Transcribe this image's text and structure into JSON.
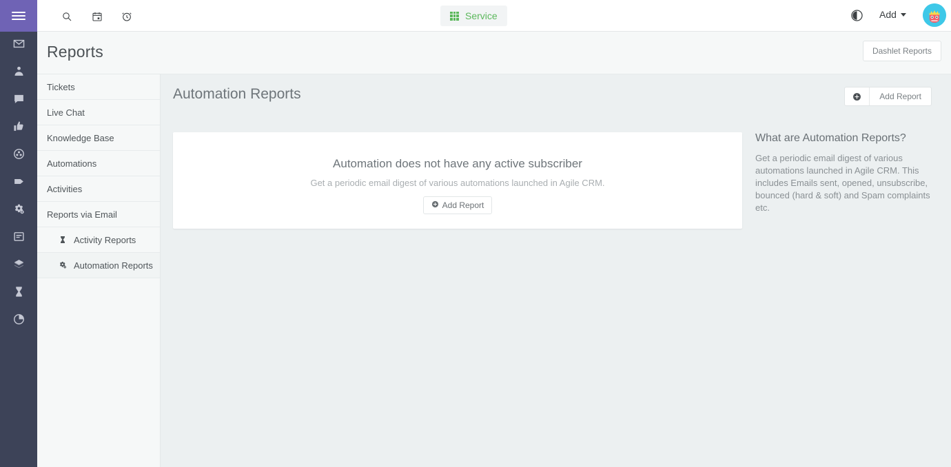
{
  "left_rail": {
    "hamburger": "menu-toggle",
    "items": [
      {
        "name": "email-icon",
        "title": "Email"
      },
      {
        "name": "contacts-icon",
        "title": "Contacts"
      },
      {
        "name": "chat-bubble-icon",
        "title": "Chat"
      },
      {
        "name": "thumbs-up-icon",
        "title": "Social"
      },
      {
        "name": "users-group-icon",
        "title": "Groups"
      },
      {
        "name": "tag-icon",
        "title": "Deals"
      },
      {
        "name": "gears-icon",
        "title": "Automations"
      },
      {
        "name": "notes-icon",
        "title": "Notes"
      },
      {
        "name": "layers-icon",
        "title": "Campaigns"
      },
      {
        "name": "hourglass-icon",
        "title": "Activities"
      },
      {
        "name": "pie-chart-icon",
        "title": "Reports"
      }
    ]
  },
  "topbar": {
    "search_icon": "search-icon",
    "calendar_icon": "calendar-icon",
    "timer_icon": "alarm-clock-icon",
    "service_label": "Service",
    "service_color": "#5cb85c",
    "darkmode_icon": "dark-mode-toggle-icon",
    "add_label": "Add",
    "avatar": "user-avatar"
  },
  "page_header": {
    "title": "Reports",
    "dashlet_button": "Dashlet Reports"
  },
  "reports_nav": {
    "items": [
      {
        "label": "Tickets",
        "icon": null,
        "sub": false,
        "active": false
      },
      {
        "label": "Live Chat",
        "icon": null,
        "sub": false,
        "active": false
      },
      {
        "label": "Knowledge Base",
        "icon": null,
        "sub": false,
        "active": false
      },
      {
        "label": "Automations",
        "icon": null,
        "sub": false,
        "active": false
      },
      {
        "label": "Activities",
        "icon": null,
        "sub": false,
        "active": false
      },
      {
        "label": "Reports via Email",
        "icon": null,
        "sub": false,
        "active": false
      },
      {
        "label": "Activity Reports",
        "icon": "hourglass-icon",
        "sub": true,
        "active": false
      },
      {
        "label": "Automation Reports",
        "icon": "gears-icon",
        "sub": true,
        "active": true
      }
    ]
  },
  "content": {
    "section_title": "Automation Reports",
    "add_report_button": "Add Report",
    "empty_state": {
      "title": "Automation does not have any active subscriber",
      "subtitle": "Get a periodic email digest of various automations launched in Agile CRM.",
      "button": "Add Report"
    },
    "info_panel": {
      "title": "What are Automation Reports?",
      "body": "Get a periodic email digest of various automations launched in Agile CRM. This includes Emails sent, opened, unsubscribe, bounced (hard & soft) and Spam complaints etc."
    }
  },
  "colors": {
    "rail_bg": "#3d4358",
    "hamburger_bg": "#6f63b5",
    "page_bg": "#ecf0f1",
    "panel_bg": "#f6f8f8",
    "accent_green": "#5cb85c"
  }
}
